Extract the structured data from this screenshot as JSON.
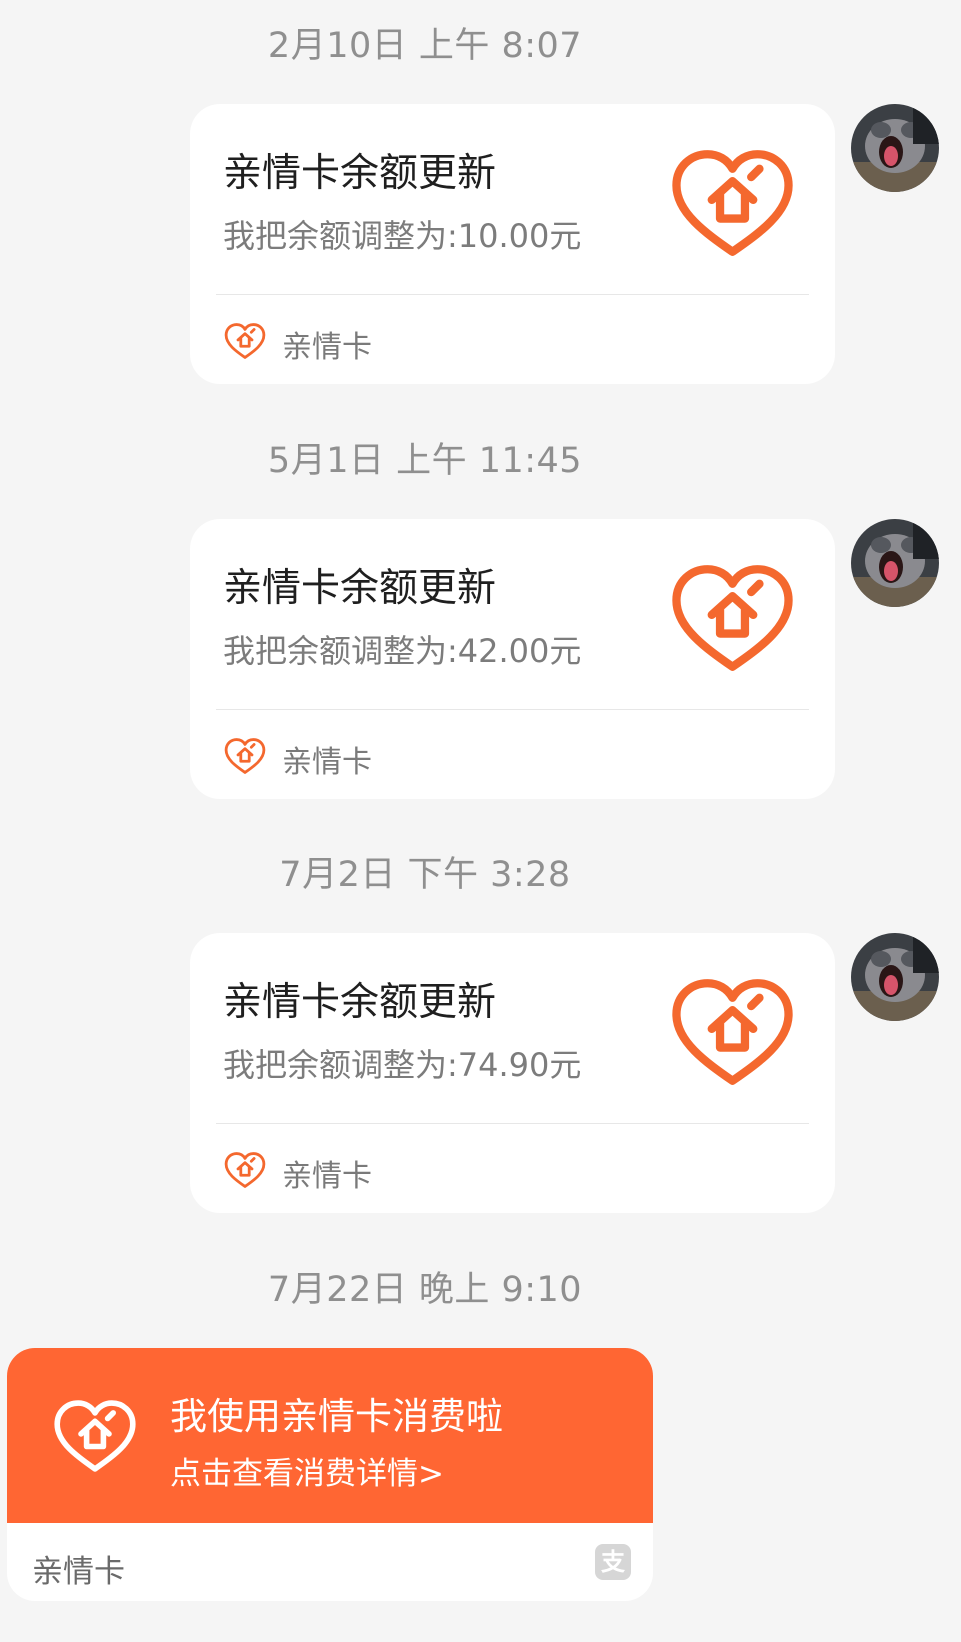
{
  "messages": [
    {
      "timestamp": "2月10日 上午 8:07",
      "card": {
        "title": "亲情卡余额更新",
        "description": "我把余额调整为:10.00元",
        "footer_label": "亲情卡"
      }
    },
    {
      "timestamp": "5月1日 上午 11:45",
      "card": {
        "title": "亲情卡余额更新",
        "description": "我把余额调整为:42.00元",
        "footer_label": "亲情卡"
      }
    },
    {
      "timestamp": "7月2日 下午 3:28",
      "card": {
        "title": "亲情卡余额更新",
        "description": "我把余额调整为:74.90元",
        "footer_label": "亲情卡"
      }
    }
  ],
  "spend_message": {
    "timestamp": "7月22日 晚上 9:10",
    "title": "我使用亲情卡消费啦",
    "subtitle": "点击查看消费详情>",
    "footer_label": "亲情卡",
    "badge_icon": "alipay-icon",
    "badge_glyph": "支"
  },
  "icons": {
    "card_icon": "heart-home-icon",
    "avatar": "user-avatar"
  },
  "colors": {
    "background": "#f5f5f5",
    "accent": "#ff6633",
    "icon_orange": "#f4682e",
    "card_background": "#ffffff",
    "timestamp_text": "#8f8f8f"
  }
}
